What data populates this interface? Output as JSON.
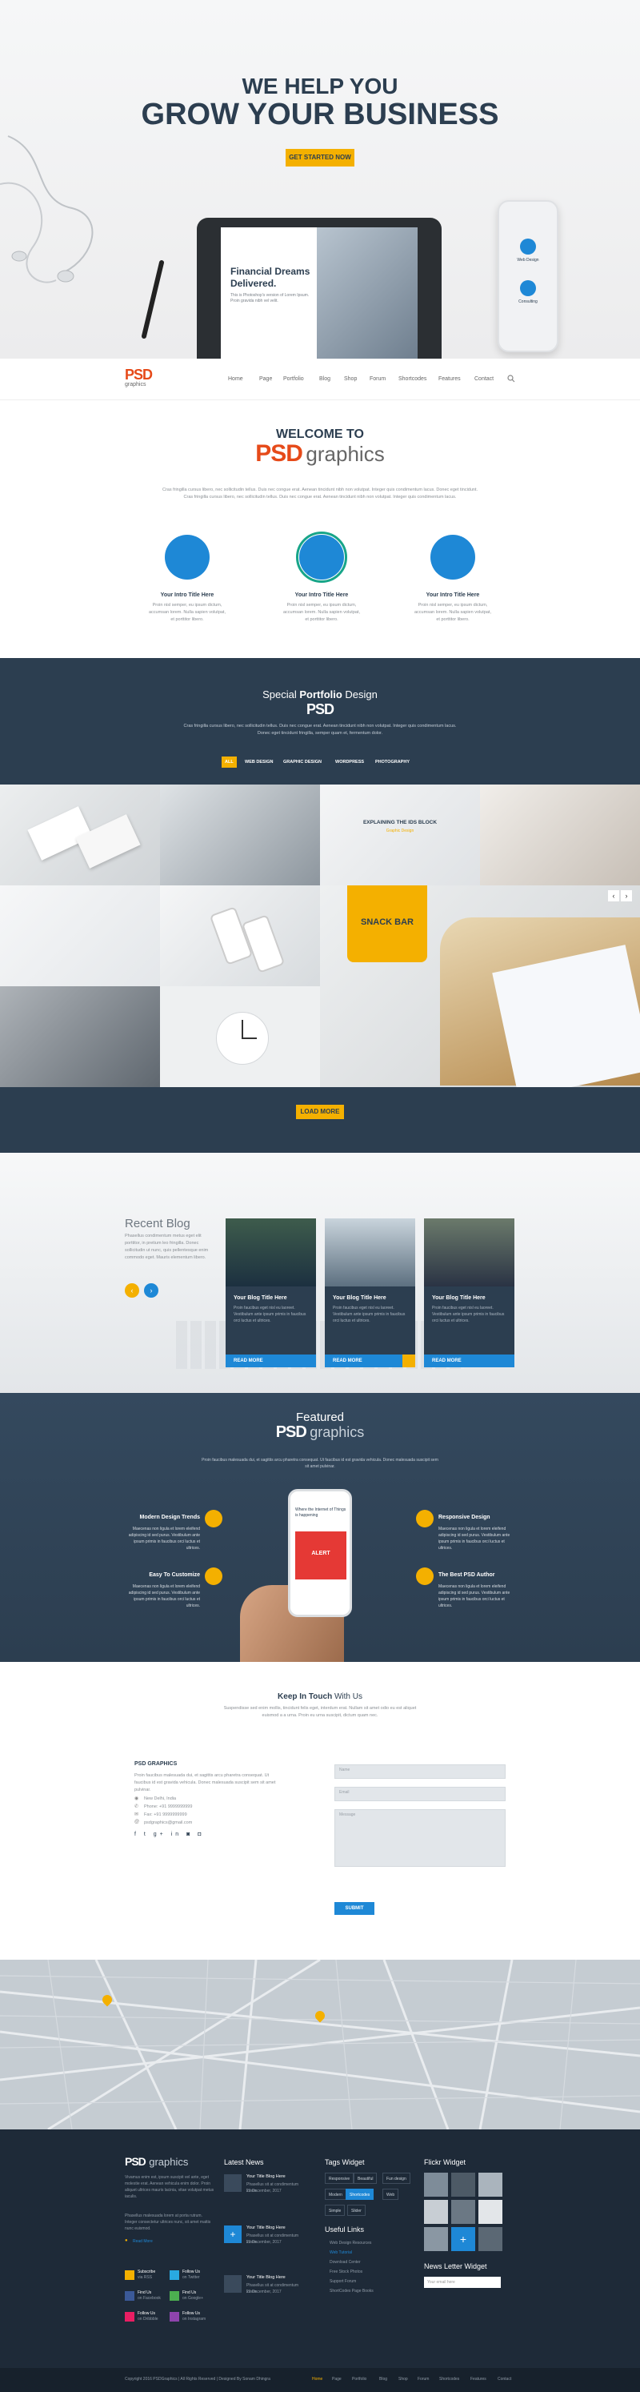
{
  "hero": {
    "line1": "WE HELP YOU",
    "line2": "GROW YOUR BUSINESS",
    "cta": "GET STARTED NOW",
    "tablet_title_1": "Financial Dreams",
    "tablet_title_2": "Delivered.",
    "tablet_text": "This is Photoshop's version of Lorem Ipsum. Proin gravida nibh vel velit.",
    "phone_label_1": "Web Design",
    "phone_label_2": "Consulting"
  },
  "nav": {
    "logo": "PSD",
    "logo_sub": "graphics",
    "items": [
      "Home",
      "Page",
      "Portfolio",
      "Blog",
      "Shop",
      "Forum",
      "Shortcodes",
      "Features",
      "Contact"
    ]
  },
  "welcome": {
    "title": "WELCOME TO",
    "brand": "PSD",
    "brand_sub": "graphics",
    "para": "Cras fringilla cursus libero, nec sollicitudin tellus. Duis nec congue erat. Aenean tincidunt nibh non volutpat. Integer quis condimentum lacus. Donec eget tincidunt. Cras fringilla cursus libero, nec sollicitudin tellus. Duis nec congue erat. Aenean tincidunt nibh non volutpat. Integer quis condimentum lacus.",
    "features": [
      {
        "title": "Your Intro Title Here",
        "text": "Proin nisl semper, eu ipsum dictum, accumsan lorem. Nulla sapien volutpat, et porttitor libero."
      },
      {
        "title": "Your Intro Title Here",
        "text": "Proin nisl semper, eu ipsum dictum, accumsan lorem. Nulla sapien volutpat, et porttitor libero."
      },
      {
        "title": "Your Intro Title Here",
        "text": "Proin nisl semper, eu ipsum dictum, accumsan lorem. Nulla sapien volutpat, et porttitor libero."
      }
    ]
  },
  "portfolio": {
    "title_pre": "Special",
    "title_bold": "Portfolio",
    "title_post": "Design",
    "brand": "PSD",
    "para": "Cras fringilla cursus libero, nec sollicitudin tellus. Duis nec congue erat. Aenean tincidunt nibh non volutpat. Integer quis condimentum lacus. Donec eget tincidunt fringilla, semper quam et, fermentum dolor.",
    "filters": [
      "ALL",
      "WEB DESIGN",
      "GRAPHIC DESIGN",
      "WORDPRESS",
      "PHOTOGRAPHY"
    ],
    "overlay_title": "EXPLAINING THE IDS BLOCK",
    "overlay_sub": "Graphic Design",
    "snack_label": "SNACK BAR",
    "load_more": "LOAD MORE"
  },
  "blog": {
    "title": "Recent Blog",
    "text": "Phasellus condimentum metus eget elit porttitor, in pretium leo fringilla. Donec sollicitudin ut nunc, quis pellentesque enim commodo eget. Mauris elementum libero.",
    "cards": [
      {
        "title": "Your Blog Title Here",
        "text": "Proin faucibus eget nisl eu laoreet. Vestibulum ante ipsum primis in faucibus orci luctus et ultrices.",
        "read": "READ MORE"
      },
      {
        "title": "Your Blog Title Here",
        "text": "Proin faucibus eget nisl eu laoreet. Vestibulum ante ipsum primis in faucibus orci luctus et ultrices.",
        "read": "READ MORE"
      },
      {
        "title": "Your Blog Title Here",
        "text": "Proin faucibus eget nisl eu laoreet. Vestibulum ante ipsum primis in faucibus orci luctus et ultrices.",
        "read": "READ MORE"
      }
    ]
  },
  "featured": {
    "title": "Featured",
    "brand": "PSD",
    "brand_sub": "graphics",
    "para": "Proin faucibus malesuada dui, et sagittis arcu pharetra consequat. Ut faucibus id est gravida vehicula. Donec malesuada suscipit sem sit amet pulvinar.",
    "left": [
      {
        "title": "Modern Design Trends",
        "text": "Maecenas non ligula et lorem eleifend adipiscing id sed purus. Vestibulum ante ipsum primis in faucibus orci luctus et ultrices."
      },
      {
        "title": "Easy To Customize",
        "text": "Maecenas non ligula et lorem eleifend adipiscing id sed purus. Vestibulum ante ipsum primis in faucibus orci luctus et ultrices."
      }
    ],
    "right": [
      {
        "title": "Responsive Design",
        "text": "Maecenas non ligula et lorem eleifend adipiscing id sed purus. Vestibulum ante ipsum primis in faucibus orci luctus et ultrices."
      },
      {
        "title": "The Best PSD Author",
        "text": "Maecenas non ligula et lorem eleifend adipiscing id sed purus. Vestibulum ante ipsum primis in faucibus orci luctus et ultrices."
      }
    ],
    "phone_app_title": "Where the Internet of Things is happening",
    "phone_alert": "ALERT"
  },
  "contact": {
    "title_bold": "Keep In Touch",
    "title_light": "With Us",
    "para": "Suspendisse sed enim mollis, tincidunt felis eget, interdum erat. Nullam sit amet odio eu est aliquet euismod a a urna. Proin eu urna suscipit, dictum quam nec.",
    "company": "PSD GRAPHICS",
    "company_text": "Proin faucibus malesuada dui, et sagittis arcu pharetra consequat. Ut faucibus id est gravida vehicula. Donec malesuada suscipit sem sit amet pulvinar.",
    "address": "New Delhi, India",
    "phone": "Phone: +91 9999999999",
    "fax": "Fax: +91 9999999999",
    "email": "psdgraphics@gmail.com",
    "name_placeholder": "Name",
    "email_placeholder": "Email",
    "message_placeholder": "Message",
    "submit": "SUBMIT"
  },
  "footer": {
    "brand": "PSD",
    "brand_sub": "graphics",
    "about": "Vivamus enim est, ipsum suscipit vel ante, eget molestie erat. Aenean vehicula enim dolor. Proin aliquet ultrices mauris lacinia, vitae volutpat metus iaculis.",
    "about2": "Phasellus malesuada lorem at porta rutrum. Integer consectetur ultrices nunc, sit amet mattis nunc euismod.",
    "read_more": "Read More",
    "social": [
      {
        "name": "Subscribe",
        "sub": "via RSS",
        "color": "#f4b000"
      },
      {
        "name": "Follow Us",
        "sub": "on Twitter",
        "color": "#29a9e1"
      },
      {
        "name": "Find Us",
        "sub": "on Facebook",
        "color": "#3b5998"
      },
      {
        "name": "Find Us",
        "sub": "on Google+",
        "color": "#4caf50"
      },
      {
        "name": "Follow Us",
        "sub": "on Dribbble",
        "color": "#e91e63"
      },
      {
        "name": "Follow Us",
        "sub": "on Instagram",
        "color": "#8e44ad"
      }
    ],
    "news_title": "Latest News",
    "news": [
      {
        "title": "Your Title Blog Here",
        "text": "Phasellus sit at condimentum lorem.",
        "date": "21 December, 2017"
      },
      {
        "title": "Your Title Blog Here",
        "text": "Phasellus sit at condimentum lorem.",
        "date": "21 December, 2017"
      },
      {
        "title": "Your Title Blog Here",
        "text": "Phasellus sit at condimentum lorem.",
        "date": "21 December, 2017"
      }
    ],
    "tags_title": "Tags Widget",
    "tags": [
      "Responsive",
      "Beautiful",
      "Fun design",
      "Modern",
      "Shortcodes",
      "Web",
      "Simple",
      "Slider"
    ],
    "links_title": "Useful Links",
    "links": [
      "Web Design Resources",
      "Web Tutorial",
      "Download Center",
      "Free Stock Photos",
      "Support Forum",
      "ShortCodes Page Books"
    ],
    "flickr_title": "Flickr Widget",
    "newsletter_title": "News Letter Widget",
    "newsletter_placeholder": "Your email here",
    "copyright": "Copyright 2016 PSDGraphics  |  All Rights Reserved  |  Designed By Sonam Dhingra",
    "bottom_nav": [
      "Home",
      "Page",
      "Portfolio",
      "Blog",
      "Shop",
      "Forum",
      "Shortcodes",
      "Features",
      "Contact"
    ]
  }
}
